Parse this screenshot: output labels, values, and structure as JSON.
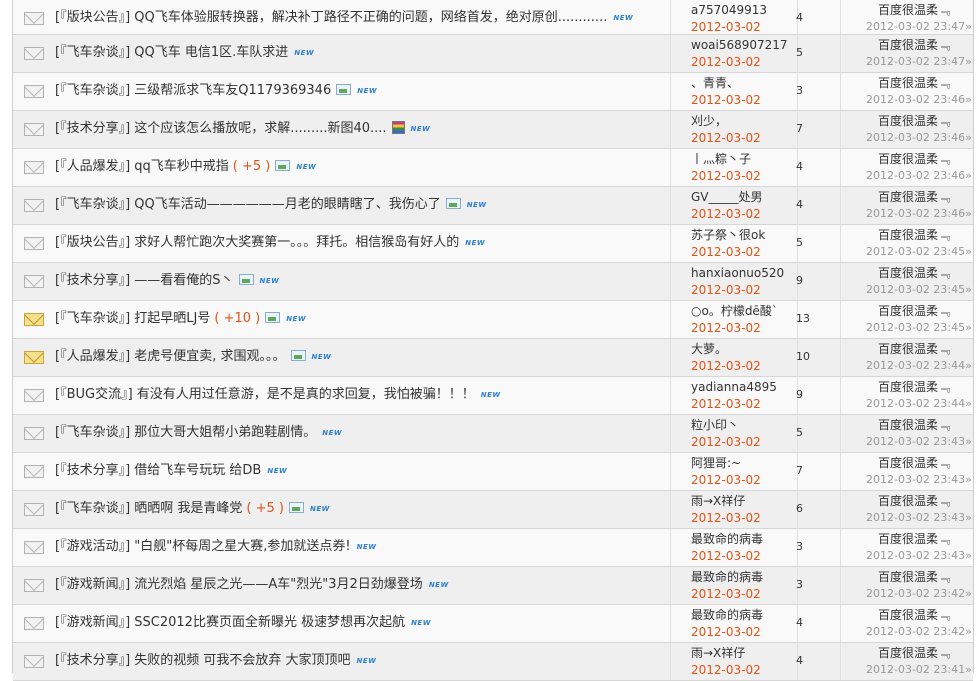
{
  "threads": [
    {
      "icon": "envelope-icon",
      "title": "[『版块公告』] QQ飞车体验服转换器，解决补丁路径不正确的问题，网络首发，绝对原创............",
      "credit": "",
      "attach": "",
      "new": "NEW",
      "author": "a757049913",
      "date": "2012-03-02",
      "replies": "4",
      "last_poster": "百度很温柔﹃",
      "last_time": "2012-03-02 23:47»"
    },
    {
      "icon": "envelope-icon",
      "title": "[『飞车杂谈』] QQ飞车 电信1区.车队求进",
      "credit": "",
      "attach": "",
      "new": "NEW",
      "author": "woai568907217",
      "date": "2012-03-02",
      "replies": "5",
      "last_poster": "百度很温柔﹃",
      "last_time": "2012-03-02 23:47»"
    },
    {
      "icon": "envelope-icon",
      "title": "[『飞车杂谈』] 三级帮派求飞车友Q1179369346",
      "credit": "",
      "attach": "image-icon",
      "new": "NEW",
      "author": "、青青、",
      "date": "2012-03-02",
      "replies": "3",
      "last_poster": "百度很温柔﹃",
      "last_time": "2012-03-02 23:46»"
    },
    {
      "icon": "envelope-icon",
      "title": "[『技术分享』] 这个应该怎么播放呢，求解.........新图40....",
      "credit": "",
      "attach": "archive-icon",
      "new": "NEW",
      "author": "刈少，",
      "date": "2012-03-02",
      "replies": "7",
      "last_poster": "百度很温柔﹃",
      "last_time": "2012-03-02 23:46»"
    },
    {
      "icon": "envelope-icon",
      "title": "[『人品爆发』] qq飞车秒中戒指",
      "credit": "( +5 )",
      "attach": "image-icon",
      "new": "NEW",
      "author": "丨灬粽丶子",
      "date": "2012-03-02",
      "replies": "4",
      "last_poster": "百度很温柔﹃",
      "last_time": "2012-03-02 23:46»"
    },
    {
      "icon": "envelope-icon",
      "title": "[『飞车杂谈』] QQ飞车活动——————月老的眼睛瞎了、我伤心了",
      "credit": "",
      "attach": "image-icon",
      "new": "NEW",
      "author": "GV_____处男",
      "date": "2012-03-02",
      "replies": "4",
      "last_poster": "百度很温柔﹃",
      "last_time": "2012-03-02 23:46»"
    },
    {
      "icon": "envelope-icon",
      "title": "[『版块公告』] 求好人帮忙跑次大奖赛第一。。。拜托。相信猴岛有好人的",
      "credit": "",
      "attach": "",
      "new": "NEW",
      "author": "苏子祭丶很ok",
      "date": "2012-03-02",
      "replies": "5",
      "last_poster": "百度很温柔﹃",
      "last_time": "2012-03-02 23:45»"
    },
    {
      "icon": "envelope-icon",
      "title": "[『技术分享』] ——看看俺的S丶",
      "credit": "",
      "attach": "image-icon",
      "new": "NEW",
      "author": "hanxiaonuo520",
      "date": "2012-03-02",
      "replies": "9",
      "last_poster": "百度很温柔﹃",
      "last_time": "2012-03-02 23:45»"
    },
    {
      "icon": "hot-envelope-icon",
      "title": "[『飞车杂谈』] 打起早晒LJ号",
      "credit": "( +10 )",
      "attach": "image-icon",
      "new": "NEW",
      "author": "○o。柠檬dē酸`",
      "date": "2012-03-02",
      "replies": "13",
      "last_poster": "百度很温柔﹃",
      "last_time": "2012-03-02 23:45»"
    },
    {
      "icon": "hot-envelope-icon",
      "title": "[『人品爆发』] 老虎号便宜卖, 求围观。。。",
      "credit": "",
      "attach": "image-icon",
      "new": "NEW",
      "author": "大萝。",
      "date": "2012-03-02",
      "replies": "10",
      "last_poster": "百度很温柔﹃",
      "last_time": "2012-03-02 23:44»"
    },
    {
      "icon": "envelope-icon",
      "title": "[『BUG交流』] 有没有人用过任意游，是不是真的求回复，我怕被骗！！！",
      "credit": "",
      "attach": "",
      "new": "NEW",
      "author": "yadianna4895",
      "date": "2012-03-02",
      "replies": "9",
      "last_poster": "百度很温柔﹃",
      "last_time": "2012-03-02 23:44»"
    },
    {
      "icon": "envelope-icon",
      "title": "[『飞车杂谈』] 那位大哥大姐帮小弟跑鞋剧情。",
      "credit": "",
      "attach": "",
      "new": "NEW",
      "author": "粒小印丶",
      "date": "2012-03-02",
      "replies": "5",
      "last_poster": "百度很温柔﹃",
      "last_time": "2012-03-02 23:43»"
    },
    {
      "icon": "envelope-icon",
      "title": "[『技术分享』] 借给飞车号玩玩  给DB",
      "credit": "",
      "attach": "",
      "new": "NEW",
      "author": "阿狸哥:~",
      "date": "2012-03-02",
      "replies": "7",
      "last_poster": "百度很温柔﹃",
      "last_time": "2012-03-02 23:43»"
    },
    {
      "icon": "envelope-icon",
      "title": "[『飞车杂谈』] 晒晒啊  我是青峰党",
      "credit": "( +5 )",
      "attach": "image-icon",
      "new": "NEW",
      "author": "雨→X祥仔",
      "date": "2012-03-02",
      "replies": "6",
      "last_poster": "百度很温柔﹃",
      "last_time": "2012-03-02 23:43»"
    },
    {
      "icon": "envelope-icon",
      "title": "[『游戏活动』] \"白舰\"杯每周之星大赛,参加就送点券!",
      "credit": "",
      "attach": "",
      "new": "NEW",
      "author": "最致命的病毒",
      "date": "2012-03-02",
      "replies": "3",
      "last_poster": "百度很温柔﹃",
      "last_time": "2012-03-02 23:43»"
    },
    {
      "icon": "envelope-icon",
      "title": "[『游戏新闻』] 流光烈焰 星辰之光——A车\"烈光\"3月2日劲爆登场",
      "credit": "",
      "attach": "",
      "new": "NEW",
      "author": "最致命的病毒",
      "date": "2012-03-02",
      "replies": "3",
      "last_poster": "百度很温柔﹃",
      "last_time": "2012-03-02 23:42»"
    },
    {
      "icon": "envelope-icon",
      "title": "[『游戏新闻』] SSC2012比赛页面全新曝光 极速梦想再次起航",
      "credit": "",
      "attach": "",
      "new": "NEW",
      "author": "最致命的病毒",
      "date": "2012-03-02",
      "replies": "4",
      "last_poster": "百度很温柔﹃",
      "last_time": "2012-03-02 23:42»"
    },
    {
      "icon": "envelope-icon",
      "title": "[『技术分享』] 失败的视频 可我不会放弃 大家顶顶吧",
      "credit": "",
      "attach": "",
      "new": "NEW",
      "author": "雨→X祥仔",
      "date": "2012-03-02",
      "replies": "4",
      "last_poster": "百度很温柔﹃",
      "last_time": "2012-03-02 23:41»"
    }
  ]
}
